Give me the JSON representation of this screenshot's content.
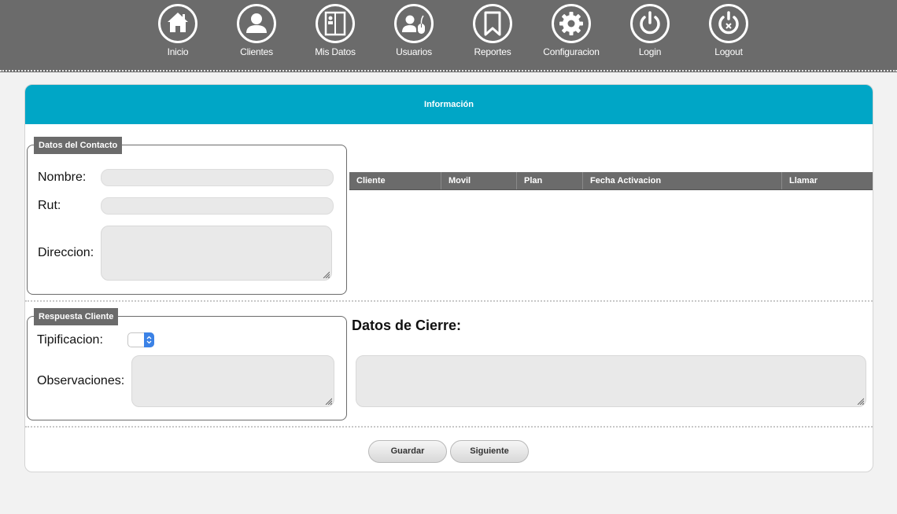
{
  "nav": {
    "items": [
      {
        "label": "Inicio",
        "icon": "home-icon"
      },
      {
        "label": "Clientes",
        "icon": "user-icon"
      },
      {
        "label": "Mis Datos",
        "icon": "id-card-icon"
      },
      {
        "label": "Usuarios",
        "icon": "users-mouse-icon"
      },
      {
        "label": "Reportes",
        "icon": "bookmark-icon"
      },
      {
        "label": "Configuracion",
        "icon": "gear-icon"
      },
      {
        "label": "Login",
        "icon": "power-icon"
      },
      {
        "label": "Logout",
        "icon": "power-off-icon"
      }
    ]
  },
  "panel": {
    "title": "Información"
  },
  "contacto": {
    "legend": "Datos del Contacto",
    "nombre_label": "Nombre:",
    "nombre_value": "",
    "rut_label": "Rut:",
    "rut_value": "",
    "direccion_label": "Direccion:",
    "direccion_value": ""
  },
  "table": {
    "columns": [
      "Cliente",
      "Movil",
      "Plan",
      "Fecha Activacion",
      "Llamar"
    ],
    "rows": []
  },
  "respuesta": {
    "legend": "Respuesta Cliente",
    "tipificacion_label": "Tipificacion:",
    "tipificacion_value": "",
    "observaciones_label": "Observaciones:",
    "observaciones_value": ""
  },
  "cierre": {
    "title": "Datos de Cierre:",
    "value": ""
  },
  "actions": {
    "guardar_label": "Guardar",
    "siguiente_label": "Siguiente"
  },
  "colors": {
    "topbar": "#6b6b6b",
    "header_accent": "#00a6c6",
    "select_accent": "#3b82e6"
  }
}
